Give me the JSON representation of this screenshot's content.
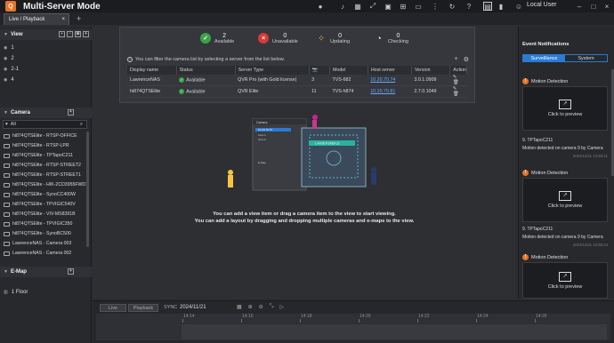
{
  "app": {
    "title": "Multi-Server Mode",
    "user": "Local User",
    "accent": "#e8732a"
  },
  "tabs": [
    {
      "label": "Live / Playback",
      "close": "×"
    }
  ],
  "tab_add": "+",
  "view": {
    "title": "View",
    "items": [
      "1",
      "2",
      "2-1",
      "4"
    ]
  },
  "camera": {
    "title": "Camera",
    "filter": "All",
    "items": [
      "hi874QTSElite - RTSP-OFFICE",
      "hi874QTSElite - RTSP-LPR",
      "hi874QTSElite - TPTapoC211",
      "hi874QTSElite - RTSP-STREET2",
      "hi874QTSElite - RTSP-STREET1",
      "hi874QTSElite - HIK-2CD3955FWD1",
      "hi874QTSElite - SynoCC400W",
      "hi874QTSElite - TPVIGIC540V",
      "hi874QTSElite - VIV-MS8391B",
      "hi874QTSElite - TPVIGIC350",
      "hi874QTSElite - SynoBC500",
      "LawrenceNAS - Camera 003",
      "LawrenceNAS - Camera 002"
    ]
  },
  "emap": {
    "title": "E-Map",
    "items": [
      "1 Floor"
    ]
  },
  "server_panel": {
    "stats": [
      {
        "value": "2",
        "label": "Available",
        "color": "#3ba344",
        "glyph": "✓"
      },
      {
        "value": "0",
        "label": "Unavailable",
        "color": "#d63a3a",
        "glyph": "×"
      },
      {
        "value": "0",
        "label": "Updating",
        "color": "#e8a13a",
        "glyph": "⁘"
      },
      {
        "value": "0",
        "label": "Checking",
        "color": "#ffffff",
        "glyph": "◔"
      }
    ],
    "hint": "You can filter the camera list by selecting a server from the list below.",
    "columns": [
      "Display name",
      "Status",
      "Server Type",
      "📷",
      "Model",
      "Host server",
      "Version",
      "Action"
    ],
    "rows": [
      {
        "name": "LawrenceNAS",
        "status": "Available",
        "type": "QVR Pro (with Gold license)",
        "cams": "3",
        "model": "TVS-682",
        "host": "10.20.70.74",
        "version": "3.0.1.0909"
      },
      {
        "name": "hi874QTSElite",
        "status": "Available",
        "type": "QVR Elite",
        "cams": "11",
        "model": "TVS-h874",
        "host": "10.20.70.81",
        "version": "2.7.0.1049"
      }
    ]
  },
  "illustration": {
    "list_items": [
      "Camera",
      "10.20.70.74",
      "Cam 1",
      "Cam 2",
      "E-Map"
    ],
    "drag_label": "L-AXIS P1435-LE"
  },
  "main_hints": [
    "You can add a view item or drag a camera item to the view to start viewing.",
    "You can add a layout by dragging and dropping multiple cameras and e-maps to the view."
  ],
  "events": {
    "title": "Event Notifications",
    "tabs": [
      "Surveillance",
      "System"
    ],
    "items": [
      {
        "type": "Motion Detection",
        "preview": "Click to preview",
        "camera": "9. TPTapoC211",
        "message": "Motion detected on camera 9 by Camera",
        "time": "2024/11/21 13:58:41"
      },
      {
        "type": "Motion Detection",
        "preview": "Click to preview",
        "camera": "9. TPTapoC211",
        "message": "Motion detected on camera 9 by Camera",
        "time": "2024/11/21 13:58:24"
      },
      {
        "type": "Motion Detection",
        "preview": "Click to preview",
        "camera": "",
        "message": "",
        "time": ""
      }
    ]
  },
  "timeline": {
    "live": "Live",
    "playback": "Playback",
    "sync": "SYNC",
    "date": "2024/11/21",
    "ticks": [
      "14:14",
      "14:16",
      "14:18",
      "14:20",
      "14:22",
      "14:24",
      "14:26"
    ]
  }
}
